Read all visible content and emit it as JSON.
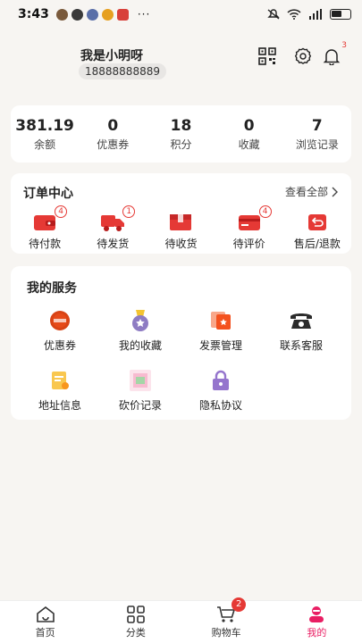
{
  "status_bar": {
    "time": "3:43",
    "more": "···"
  },
  "profile": {
    "username": "我是小明呀",
    "phone": "18888888889",
    "notification_count": "3"
  },
  "stats": [
    {
      "value": "381.19",
      "label": "余额"
    },
    {
      "value": "0",
      "label": "优惠券"
    },
    {
      "value": "18",
      "label": "积分"
    },
    {
      "value": "0",
      "label": "收藏"
    },
    {
      "value": "7",
      "label": "浏览记录"
    }
  ],
  "orders": {
    "title": "订单中心",
    "view_all": "查看全部",
    "items": [
      {
        "label": "待付款",
        "badge": "4",
        "icon": "wallet-icon"
      },
      {
        "label": "待发货",
        "badge": "1",
        "icon": "truck-icon"
      },
      {
        "label": "待收货",
        "badge": "",
        "icon": "box-icon"
      },
      {
        "label": "待评价",
        "badge": "4",
        "icon": "card-icon"
      },
      {
        "label": "售后/退款",
        "badge": "",
        "icon": "refund-icon"
      }
    ]
  },
  "services": {
    "title": "我的服务",
    "items": [
      {
        "label": "优惠券",
        "icon": "coupon-icon"
      },
      {
        "label": "我的收藏",
        "icon": "medal-icon"
      },
      {
        "label": "发票管理",
        "icon": "invoice-icon"
      },
      {
        "label": "联系客服",
        "icon": "phone-icon"
      },
      {
        "label": "地址信息",
        "icon": "address-icon"
      },
      {
        "label": "砍价记录",
        "icon": "bargain-icon"
      },
      {
        "label": "隐私协议",
        "icon": "lock-icon"
      }
    ]
  },
  "tabs": [
    {
      "label": "首页",
      "icon": "home-icon"
    },
    {
      "label": "分类",
      "icon": "grid-icon"
    },
    {
      "label": "购物车",
      "icon": "cart-icon",
      "badge": "2"
    },
    {
      "label": "我的",
      "icon": "user-icon"
    }
  ],
  "colors": {
    "accent": "#e53935",
    "active_tab": "#e91e63",
    "background": "#f7f5f2"
  }
}
